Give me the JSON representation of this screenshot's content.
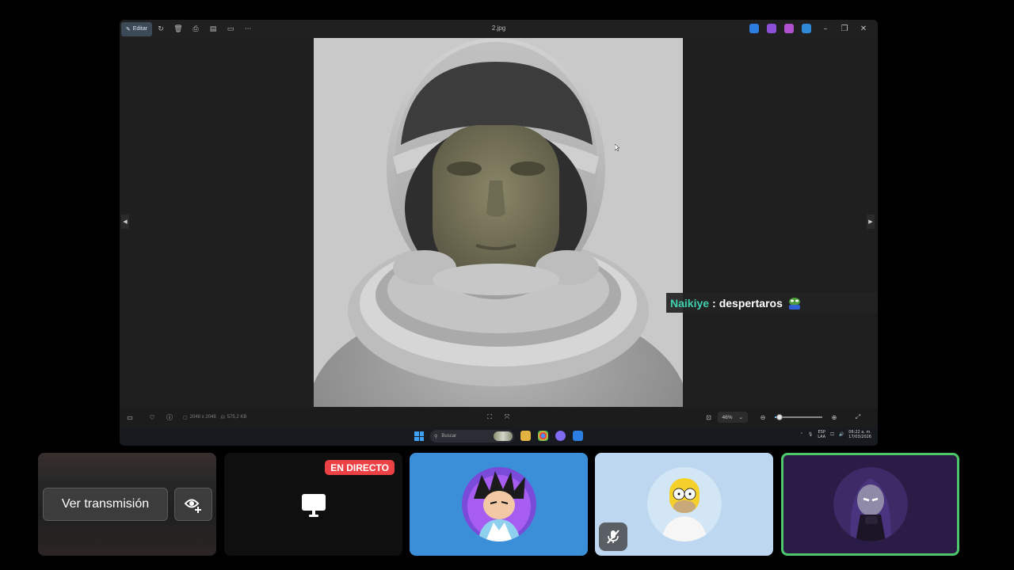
{
  "viewer": {
    "title": "2.jpg",
    "edit_label": "Editar",
    "image_dims": "2048 x 2048",
    "file_size": "575,2 KB",
    "zoom": "46%",
    "zoom_fraction": 0.1
  },
  "taskbar": {
    "search_placeholder": "Buscar",
    "lang_top": "ESP",
    "lang_bottom": "LAA",
    "time": "06:22 a. m.",
    "date": "17/03/2026"
  },
  "chat": {
    "username": "Naikiye",
    "separator": ":",
    "message": "despertaros"
  },
  "tiles": {
    "watch_label": "Ver transmisión",
    "live_label": "EN DIRECTO"
  },
  "colors": {
    "chat_user": "#3fd0b0",
    "live": "#ed4245",
    "speaking_border": "#4cc76a",
    "tile_blue": "#3b8fd8",
    "tile_lightblue": "#bcd7ef",
    "tile_purple": "#2a1c46"
  }
}
